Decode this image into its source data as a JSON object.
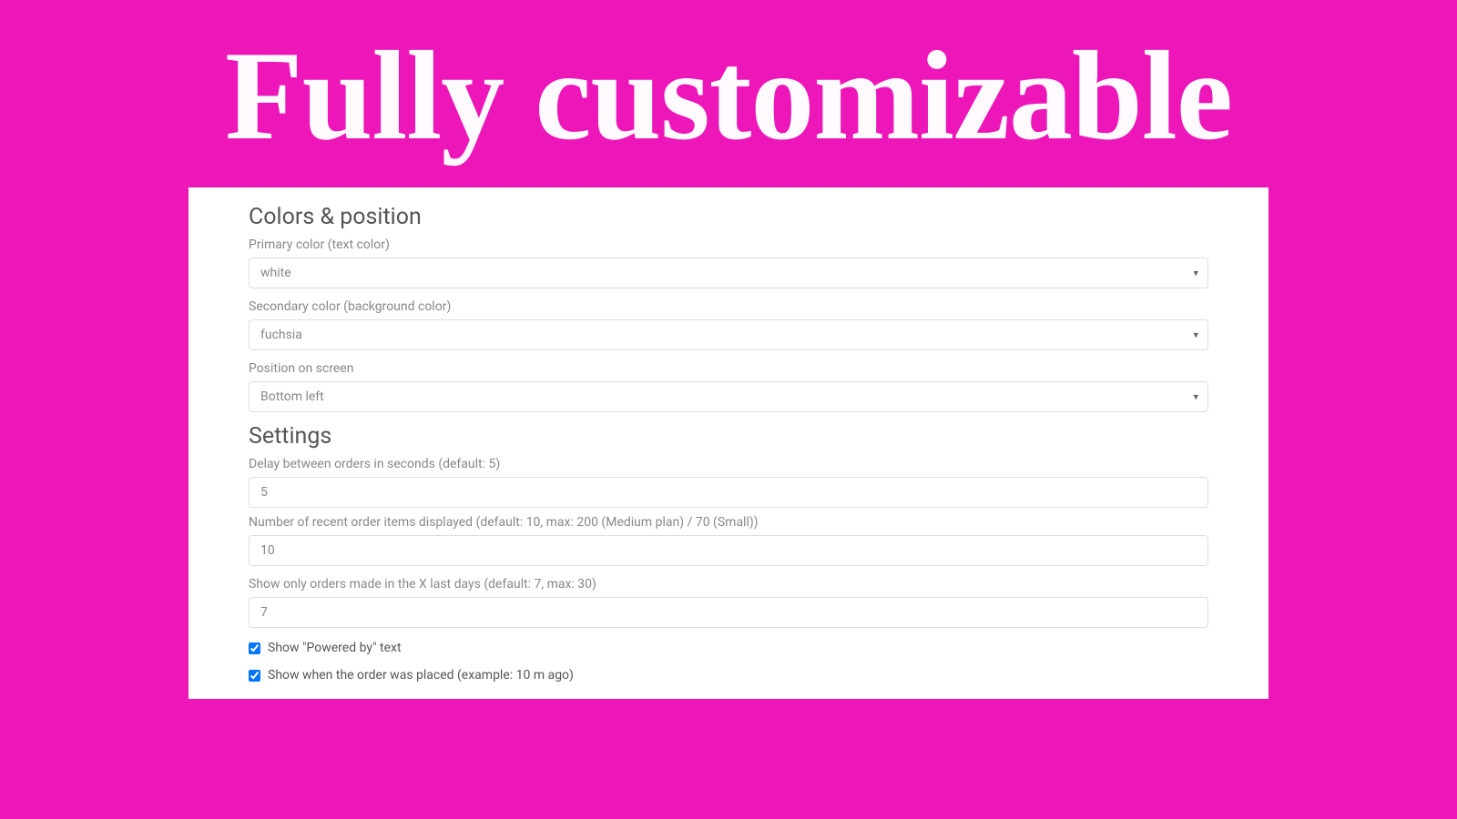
{
  "hero": {
    "title": "Fully customizable"
  },
  "sections": {
    "colors": {
      "heading": "Colors & position",
      "primary": {
        "label": "Primary color (text color)",
        "value": "white"
      },
      "secondary": {
        "label": "Secondary color (background color)",
        "value": "fuchsia"
      },
      "position": {
        "label": "Position on screen",
        "value": "Bottom left"
      }
    },
    "settings": {
      "heading": "Settings",
      "delay": {
        "label": "Delay between orders in seconds (default: 5)",
        "value": "5"
      },
      "orderItems": {
        "label": "Number of recent order items displayed (default: 10, max: 200 (Medium plan) / 70 (Small))",
        "value": "10"
      },
      "lastDays": {
        "label": "Show only orders made in the X last days (default: 7, max: 30)",
        "value": "7"
      },
      "showPoweredBy": {
        "label": "Show \"Powered by\" text",
        "checked": true
      },
      "showWhenPlaced": {
        "label": "Show when the order was placed (example: 10 m ago)",
        "checked": true
      }
    }
  }
}
